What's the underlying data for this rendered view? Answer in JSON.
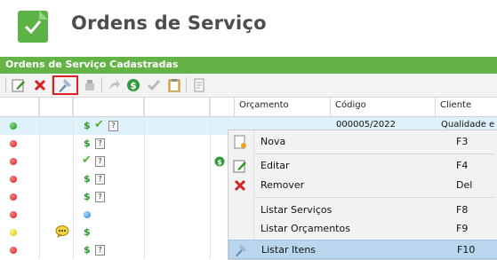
{
  "header": {
    "title": "Ordens de Serviço"
  },
  "panel": {
    "title": "Ordens de Serviço Cadastradas"
  },
  "toolbar": {
    "icons": [
      "edit-icon",
      "remove-icon",
      "list-items-icon",
      "tools-icon",
      "forward-icon",
      "money-icon",
      "approve-icon",
      "clipboard-icon",
      "document-icon"
    ]
  },
  "grid": {
    "columns": {
      "orcamento": "Orçamento Aprova...",
      "codigo": "Código",
      "cliente": "Cliente"
    },
    "rows": [
      {
        "status": "green",
        "codigo": "000005/2022",
        "cliente": "Qualidade e E"
      },
      {
        "status": "red"
      },
      {
        "status": "red"
      },
      {
        "status": "red"
      },
      {
        "status": "red"
      },
      {
        "status": "red"
      },
      {
        "status": "yellow"
      },
      {
        "status": "red"
      }
    ]
  },
  "context_menu": {
    "items": [
      {
        "label": "Nova",
        "key": "F3"
      },
      {
        "label": "Editar",
        "key": "F4"
      },
      {
        "label": "Remover",
        "key": "Del"
      },
      {
        "label": "Listar Serviços",
        "key": "F8"
      },
      {
        "label": "Listar Orçamentos",
        "key": "F9"
      },
      {
        "label": "Listar Itens",
        "key": "F10"
      }
    ]
  },
  "colors": {
    "accent": "#64b347",
    "selection": "#dff1fa",
    "highlight": "#e02020"
  }
}
